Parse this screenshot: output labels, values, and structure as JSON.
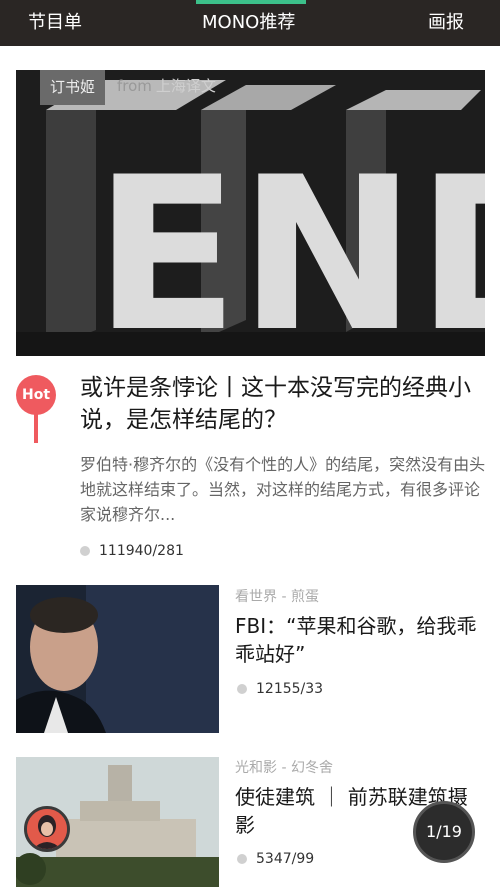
{
  "nav": {
    "tabs": [
      {
        "label": "节目单"
      },
      {
        "label": "MONO推荐"
      },
      {
        "label": "画报"
      }
    ],
    "active_tab": "MONO推荐",
    "accent_color": "#3cc08a"
  },
  "feature": {
    "tag": "订书姬",
    "from_word": "from",
    "from_source": "上海译文",
    "hero_text": "END",
    "hot_badge": "Hot",
    "title": "或许是条悖论丨这十本没写完的经典小说，是怎样结尾的？",
    "description": "罗伯特·穆齐尔的《没有个性的人》的结尾，突然没有由头地就这样结束了。当然，对这样的结尾方式，有很多评论家说穆齐尔...",
    "stats": "111940/281"
  },
  "articles": [
    {
      "source": "看世界 - 煎蛋",
      "title": "FBI：“苹果和谷歌，给我乖乖站好”",
      "stats": "12155/33"
    },
    {
      "source": "光和影 - 幻冬舍",
      "title": "使徒建筑 ｜ 前苏联建筑摄影",
      "stats": "5347/99"
    }
  ],
  "pager": {
    "label": "1/19"
  },
  "colors": {
    "hot": "#ef5a5f",
    "nav_bg": "#2a2624"
  }
}
